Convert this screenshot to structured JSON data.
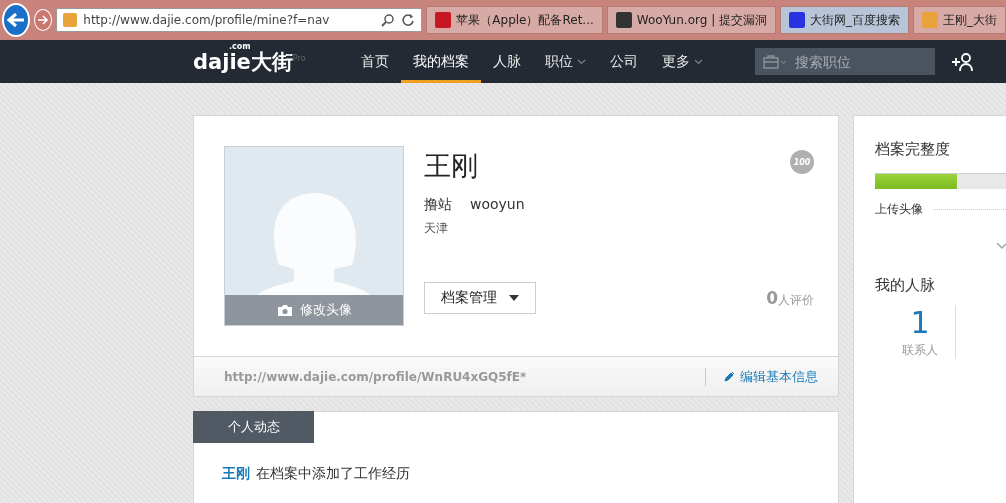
{
  "browser": {
    "address": "http://www.dajie.com/profile/mine?f=nav",
    "tabs": [
      {
        "label": "苹果（Apple）配备Ret...",
        "kind": "jd",
        "selected": false
      },
      {
        "label": "WooYun.org | 提交漏洞",
        "kind": "wooyun",
        "selected": false
      },
      {
        "label": "大街网_百度搜索",
        "kind": "baidu",
        "selected": true
      },
      {
        "label": "王刚_大街",
        "kind": "dajie",
        "selected": false
      }
    ]
  },
  "nav": {
    "logo": "dajie大街",
    "logo_dot": ".com",
    "logo_sup": "Pro",
    "items": [
      {
        "label": "首页",
        "selected": false,
        "dropdown": false
      },
      {
        "label": "我的档案",
        "selected": true,
        "dropdown": false
      },
      {
        "label": "人脉",
        "selected": false,
        "dropdown": false
      },
      {
        "label": "职位",
        "selected": false,
        "dropdown": true
      },
      {
        "label": "公司",
        "selected": false,
        "dropdown": false
      },
      {
        "label": "更多",
        "selected": false,
        "dropdown": true
      }
    ],
    "search_placeholder": "搜索职位"
  },
  "profile": {
    "name": "王刚",
    "title": "撸站",
    "company": "wooyun",
    "city": "天津",
    "avatar_action": "修改头像",
    "badge": "100",
    "manage_button": "档案管理",
    "rating_count": "0",
    "rating_label": "人评价",
    "url": "http://www.dajie.com/profile/WnRU4xGQ5fE*",
    "edit_link": "编辑基本信息"
  },
  "activity": {
    "tab": "个人动态",
    "items": [
      {
        "name": "王刚",
        "text": "在档案中添加了工作经历"
      }
    ]
  },
  "side": {
    "completeness_title": "档案完整度",
    "completeness": {
      "level": 0.6
    },
    "next_step": "上传头像",
    "network_title": "我的人脉",
    "contacts_count": "1",
    "contacts_label": "联系人"
  }
}
